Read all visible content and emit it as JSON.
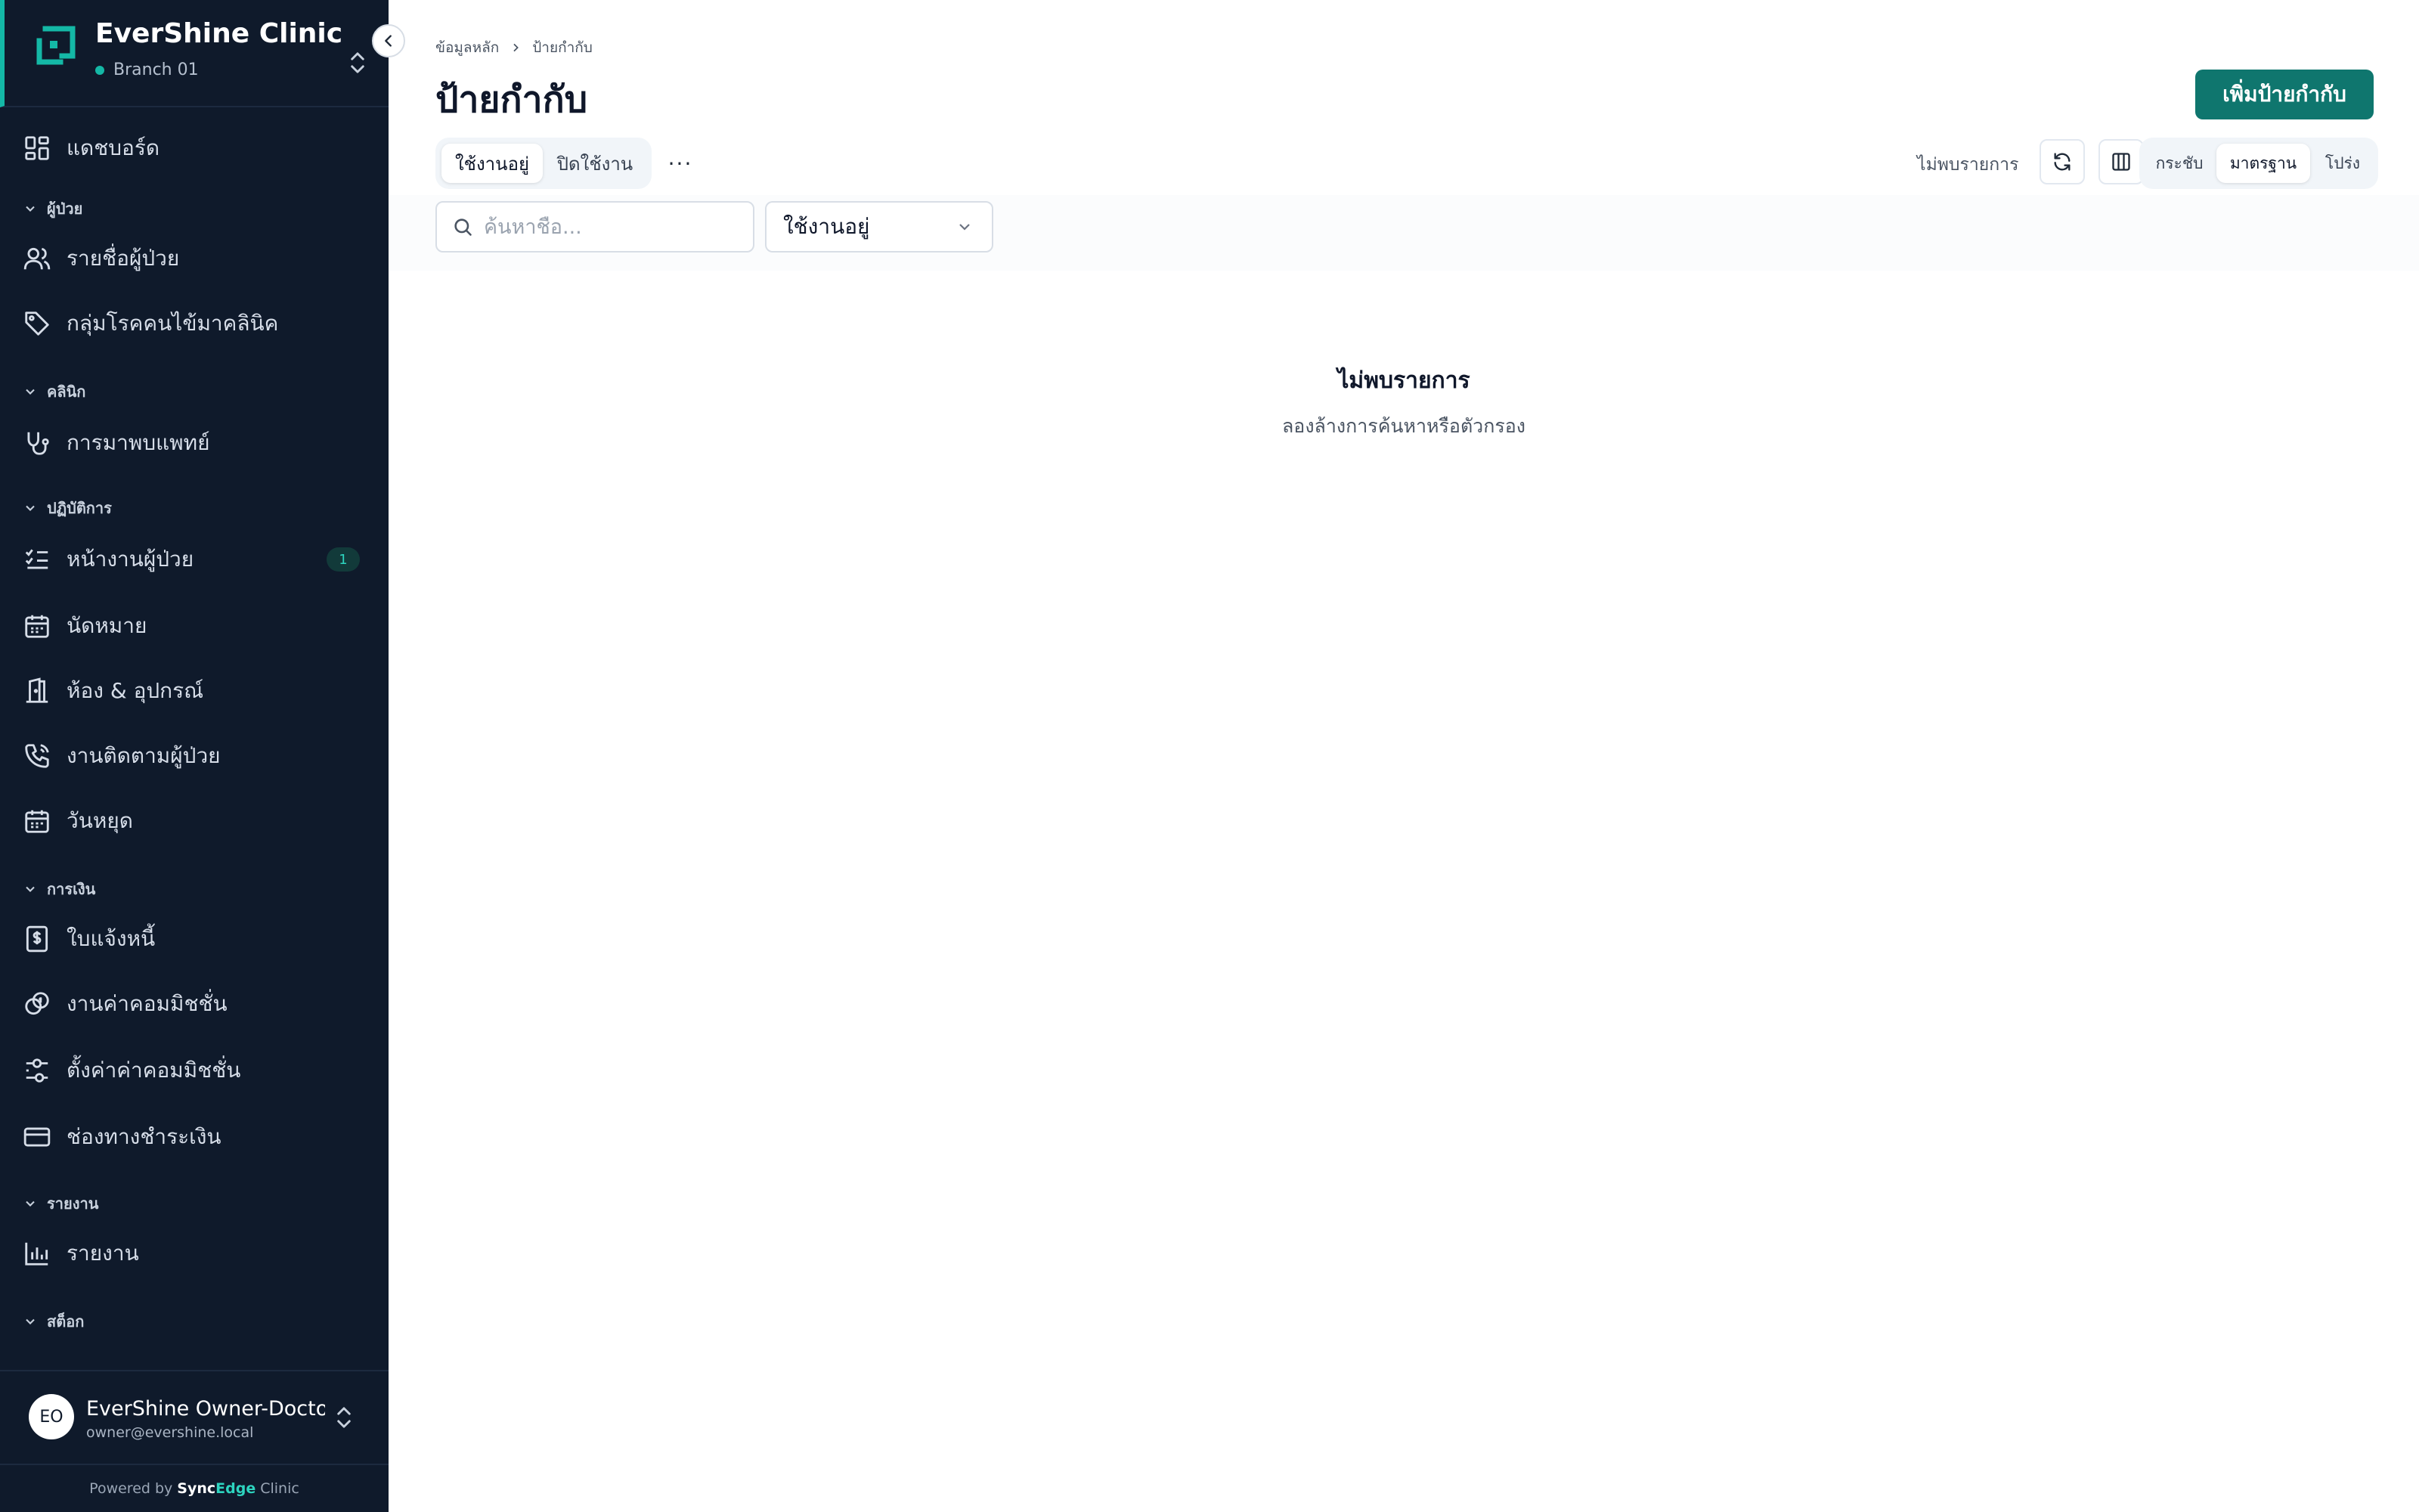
{
  "brand": {
    "name": "EverShine Clinic",
    "branch": "Branch 01"
  },
  "sidebar": {
    "items": [
      {
        "label": "แดชบอร์ด",
        "icon": "dashboard-icon"
      },
      {
        "section": "ผู้ป่วย"
      },
      {
        "label": "รายชื่อผู้ป่วย",
        "icon": "users-icon"
      },
      {
        "label": "กลุ่มโรคคนไข้มาคลินิค",
        "icon": "tag-icon"
      },
      {
        "section": "คลินิก"
      },
      {
        "label": "การมาพบแพทย์",
        "icon": "stethoscope-icon"
      },
      {
        "section": "ปฏิบัติการ"
      },
      {
        "label": "หน้างานผู้ป่วย",
        "icon": "checklist-icon",
        "badge": "1"
      },
      {
        "label": "นัดหมาย",
        "icon": "calendar-icon"
      },
      {
        "label": "ห้อง & อุปกรณ์",
        "icon": "door-icon"
      },
      {
        "label": "งานติดตามผู้ป่วย",
        "icon": "phone-icon"
      },
      {
        "label": "วันหยุด",
        "icon": "calendar-icon"
      },
      {
        "section": "การเงิน"
      },
      {
        "label": "ใบแจ้งหนี้",
        "icon": "invoice-icon"
      },
      {
        "label": "งานค่าคอมมิชชั่น",
        "icon": "coins-icon"
      },
      {
        "label": "ตั้งค่าค่าคอมมิชชั่น",
        "icon": "sliders-icon"
      },
      {
        "label": "ช่องทางชำระเงิน",
        "icon": "credit-card-icon"
      },
      {
        "section": "รายงาน"
      },
      {
        "label": "รายงาน",
        "icon": "bar-chart-icon"
      },
      {
        "section": "สต็อก"
      }
    ]
  },
  "user": {
    "initials": "EO",
    "name": "EverShine Owner-Doctor",
    "email": "owner@evershine.local"
  },
  "footer": {
    "powered_by": "Powered by",
    "brand_a": "Sync",
    "brand_b": "Edge",
    "brand_c": "Clinic"
  },
  "header": {
    "breadcrumb": [
      "ข้อมูลหลัก",
      "ป้ายกำกับ"
    ],
    "title": "ป้ายกำกับ",
    "add_button": "เพิ่มป้ายกำกับ"
  },
  "toolbar": {
    "tabs": [
      "ใช้งานอยู่",
      "ปิดใช้งาน"
    ],
    "active_tab": "ใช้งานอยู่",
    "more": "···",
    "result_text": "ไม่พบรายการ",
    "density_options": [
      "กระชับ",
      "มาตรฐาน",
      "โปร่ง"
    ],
    "active_density": "มาตรฐาน"
  },
  "filters": {
    "search_placeholder": "ค้นหาชื่อ...",
    "search_value": "",
    "status_value": "ใช้งานอยู่"
  },
  "empty_state": {
    "title": "ไม่พบรายการ",
    "subtitle": "ลองล้างการค้นหาหรือตัวกรอง"
  },
  "colors": {
    "sidebar_bg": "#0f1a2b",
    "accent": "#14b8a6",
    "primary": "#0f766e"
  }
}
